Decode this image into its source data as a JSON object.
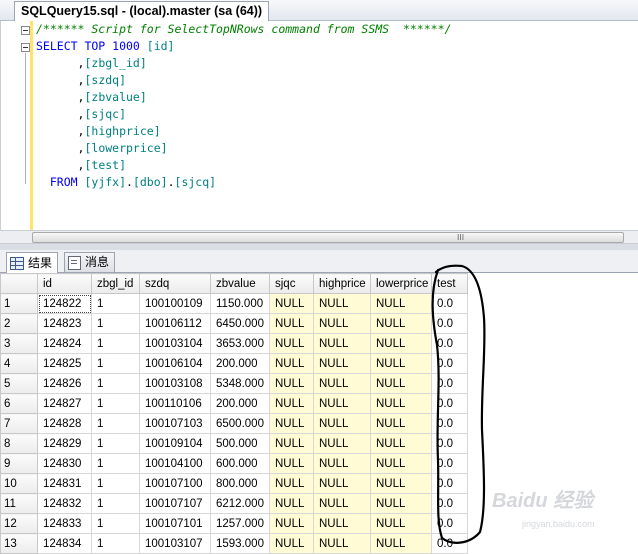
{
  "tab": {
    "title": "SQLQuery15.sql - (local).master (sa (64))"
  },
  "editor": {
    "lines": [
      [
        {
          "t": "/****** Script for SelectTopNRows command from SSMS  ******/",
          "c": "cm"
        }
      ],
      [
        {
          "t": "SELECT TOP 1000 ",
          "c": "kw"
        },
        {
          "t": "[id]",
          "c": "id"
        }
      ],
      [
        {
          "t": "      ,",
          "c": "txt"
        },
        {
          "t": "[zbgl_id]",
          "c": "id"
        }
      ],
      [
        {
          "t": "      ,",
          "c": "txt"
        },
        {
          "t": "[szdq]",
          "c": "id"
        }
      ],
      [
        {
          "t": "      ,",
          "c": "txt"
        },
        {
          "t": "[zbvalue]",
          "c": "id"
        }
      ],
      [
        {
          "t": "      ,",
          "c": "txt"
        },
        {
          "t": "[sjqc]",
          "c": "id"
        }
      ],
      [
        {
          "t": "      ,",
          "c": "txt"
        },
        {
          "t": "[highprice]",
          "c": "id"
        }
      ],
      [
        {
          "t": "      ,",
          "c": "txt"
        },
        {
          "t": "[lowerprice]",
          "c": "id"
        }
      ],
      [
        {
          "t": "      ,",
          "c": "txt"
        },
        {
          "t": "[test]",
          "c": "id"
        }
      ],
      [
        {
          "t": "  FROM ",
          "c": "kw"
        },
        {
          "t": "[yjfx]",
          "c": "id"
        },
        {
          "t": ".",
          "c": "txt"
        },
        {
          "t": "[dbo]",
          "c": "id"
        },
        {
          "t": ".",
          "c": "txt"
        },
        {
          "t": "[sjcq]",
          "c": "id"
        }
      ]
    ]
  },
  "scrollbar": {
    "grip": "III"
  },
  "results_tabs": {
    "results_label": "结果",
    "messages_label": "消息"
  },
  "grid": {
    "columns": [
      "",
      "id",
      "zbgl_id",
      "szdq",
      "zbvalue",
      "sjqc",
      "highprice",
      "lowerprice",
      "test"
    ],
    "rows": [
      [
        "1",
        "124822",
        "1",
        "100100109",
        "1150.000",
        "NULL",
        "NULL",
        "NULL",
        "0.0"
      ],
      [
        "2",
        "124823",
        "1",
        "100106112",
        "6450.000",
        "NULL",
        "NULL",
        "NULL",
        "0.0"
      ],
      [
        "3",
        "124824",
        "1",
        "100103104",
        "3653.000",
        "NULL",
        "NULL",
        "NULL",
        "0.0"
      ],
      [
        "4",
        "124825",
        "1",
        "100106104",
        "200.000",
        "NULL",
        "NULL",
        "NULL",
        "0.0"
      ],
      [
        "5",
        "124826",
        "1",
        "100103108",
        "5348.000",
        "NULL",
        "NULL",
        "NULL",
        "0.0"
      ],
      [
        "6",
        "124827",
        "1",
        "100110106",
        "200.000",
        "NULL",
        "NULL",
        "NULL",
        "0.0"
      ],
      [
        "7",
        "124828",
        "1",
        "100107103",
        "6500.000",
        "NULL",
        "NULL",
        "NULL",
        "0.0"
      ],
      [
        "8",
        "124829",
        "1",
        "100109104",
        "500.000",
        "NULL",
        "NULL",
        "NULL",
        "0.0"
      ],
      [
        "9",
        "124830",
        "1",
        "100104100",
        "600.000",
        "NULL",
        "NULL",
        "NULL",
        "0.0"
      ],
      [
        "10",
        "124831",
        "1",
        "100107100",
        "800.000",
        "NULL",
        "NULL",
        "NULL",
        "0.0"
      ],
      [
        "11",
        "124832",
        "1",
        "100107107",
        "6212.000",
        "NULL",
        "NULL",
        "NULL",
        "0.0"
      ],
      [
        "12",
        "124833",
        "1",
        "100107101",
        "1257.000",
        "NULL",
        "NULL",
        "NULL",
        "0.0"
      ],
      [
        "13",
        "124834",
        "1",
        "100103107",
        "1593.000",
        "NULL",
        "NULL",
        "NULL",
        "0.0"
      ]
    ]
  },
  "watermark": {
    "text": "Baidu 经验",
    "sub": "jingyan.baidu.com"
  },
  "colors": {
    "null_cell": "#fffbd5",
    "keyword": "#0000ff",
    "comment": "#008000",
    "identifier": "#008080",
    "annotation": "#000000"
  }
}
